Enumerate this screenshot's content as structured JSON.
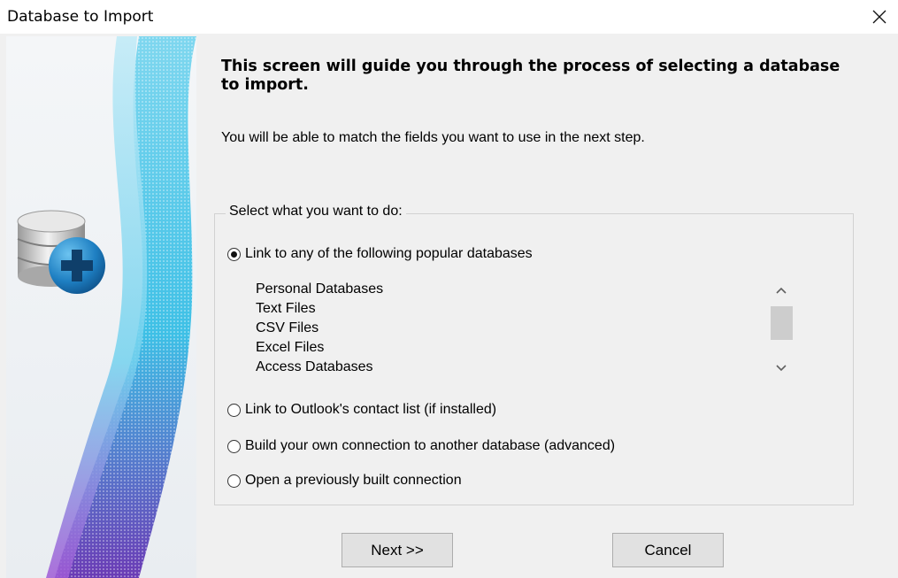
{
  "window": {
    "title": "Database to Import",
    "close_icon": "close-icon"
  },
  "content": {
    "heading": "This screen will guide you through the process of selecting a database to import.",
    "subtext": "You will be able to match the fields you want to use in the next step."
  },
  "group": {
    "label": "Select what you want to do:",
    "options": [
      {
        "label": "Link to any of the following popular databases",
        "checked": true
      },
      {
        "label": "Link to Outlook's contact list (if installed)",
        "checked": false
      },
      {
        "label": "Build your own connection to another database (advanced)",
        "checked": false
      },
      {
        "label": "Open a previously built connection",
        "checked": false
      }
    ],
    "database_list": [
      "Personal Databases",
      "Text Files",
      "CSV Files",
      "Excel Files",
      "Access Databases"
    ]
  },
  "buttons": {
    "next": "Next >>",
    "cancel": "Cancel"
  },
  "icons": {
    "banner_icon": "database-add-icon",
    "scroll_up": "chevron-up-icon",
    "scroll_down": "chevron-down-icon"
  },
  "colors": {
    "accent_blue": "#1e7fc2",
    "banner_purple": "#7b3fb6",
    "banner_cyan": "#43c7e8"
  }
}
